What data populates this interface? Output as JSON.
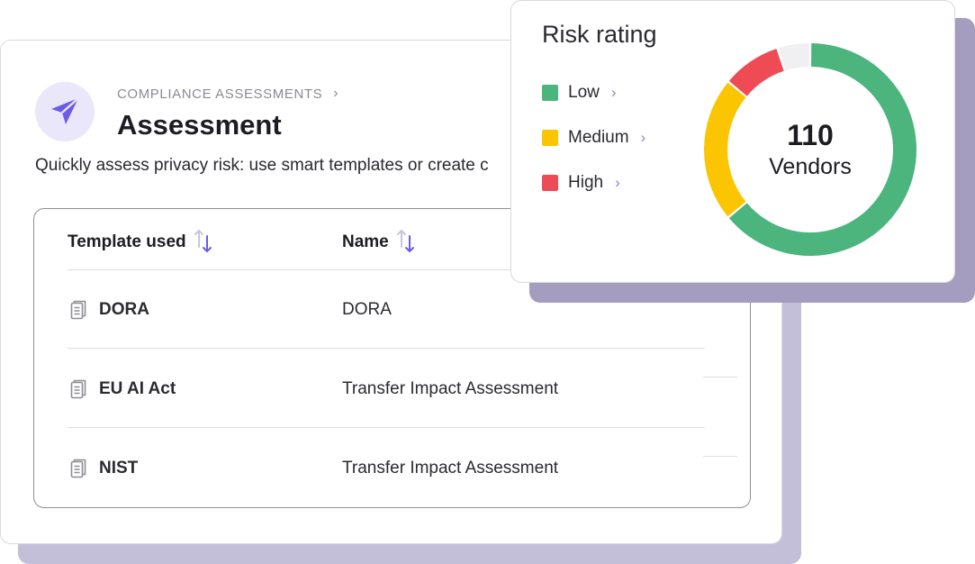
{
  "assessment": {
    "breadcrumb": "COMPLIANCE ASSESSMENTS",
    "breadcrumb_chevron": "›",
    "title": "Assessment",
    "subtitle": "Quickly assess privacy risk: use smart templates or create c",
    "header_icon": "paper-plane-icon",
    "accent_color": "#6b5be6",
    "table": {
      "columns": [
        "Template used",
        "Name"
      ],
      "rows": [
        {
          "template": "DORA",
          "name": "DORA"
        },
        {
          "template": "EU AI Act",
          "name": "Transfer Impact Assessment"
        },
        {
          "template": "NIST",
          "name": "Transfer Impact Assessment"
        }
      ]
    }
  },
  "risk_rating": {
    "title": "Risk rating",
    "total": "110",
    "unit": "Vendors",
    "legend": [
      {
        "label": "Low",
        "color": "#4bb57d"
      },
      {
        "label": "Medium",
        "color": "#fbc501"
      },
      {
        "label": "High",
        "color": "#ef4b55"
      }
    ],
    "legend_chevron": "›",
    "segments": [
      {
        "label": "Low",
        "fraction": 0.64,
        "color": "#4bb57d"
      },
      {
        "label": "Medium",
        "fraction": 0.22,
        "color": "#fbc501"
      },
      {
        "label": "High",
        "fraction": 0.09,
        "color": "#ef4b55"
      },
      {
        "label": "",
        "fraction": 0.05,
        "color": "#f0f0f2"
      }
    ]
  }
}
